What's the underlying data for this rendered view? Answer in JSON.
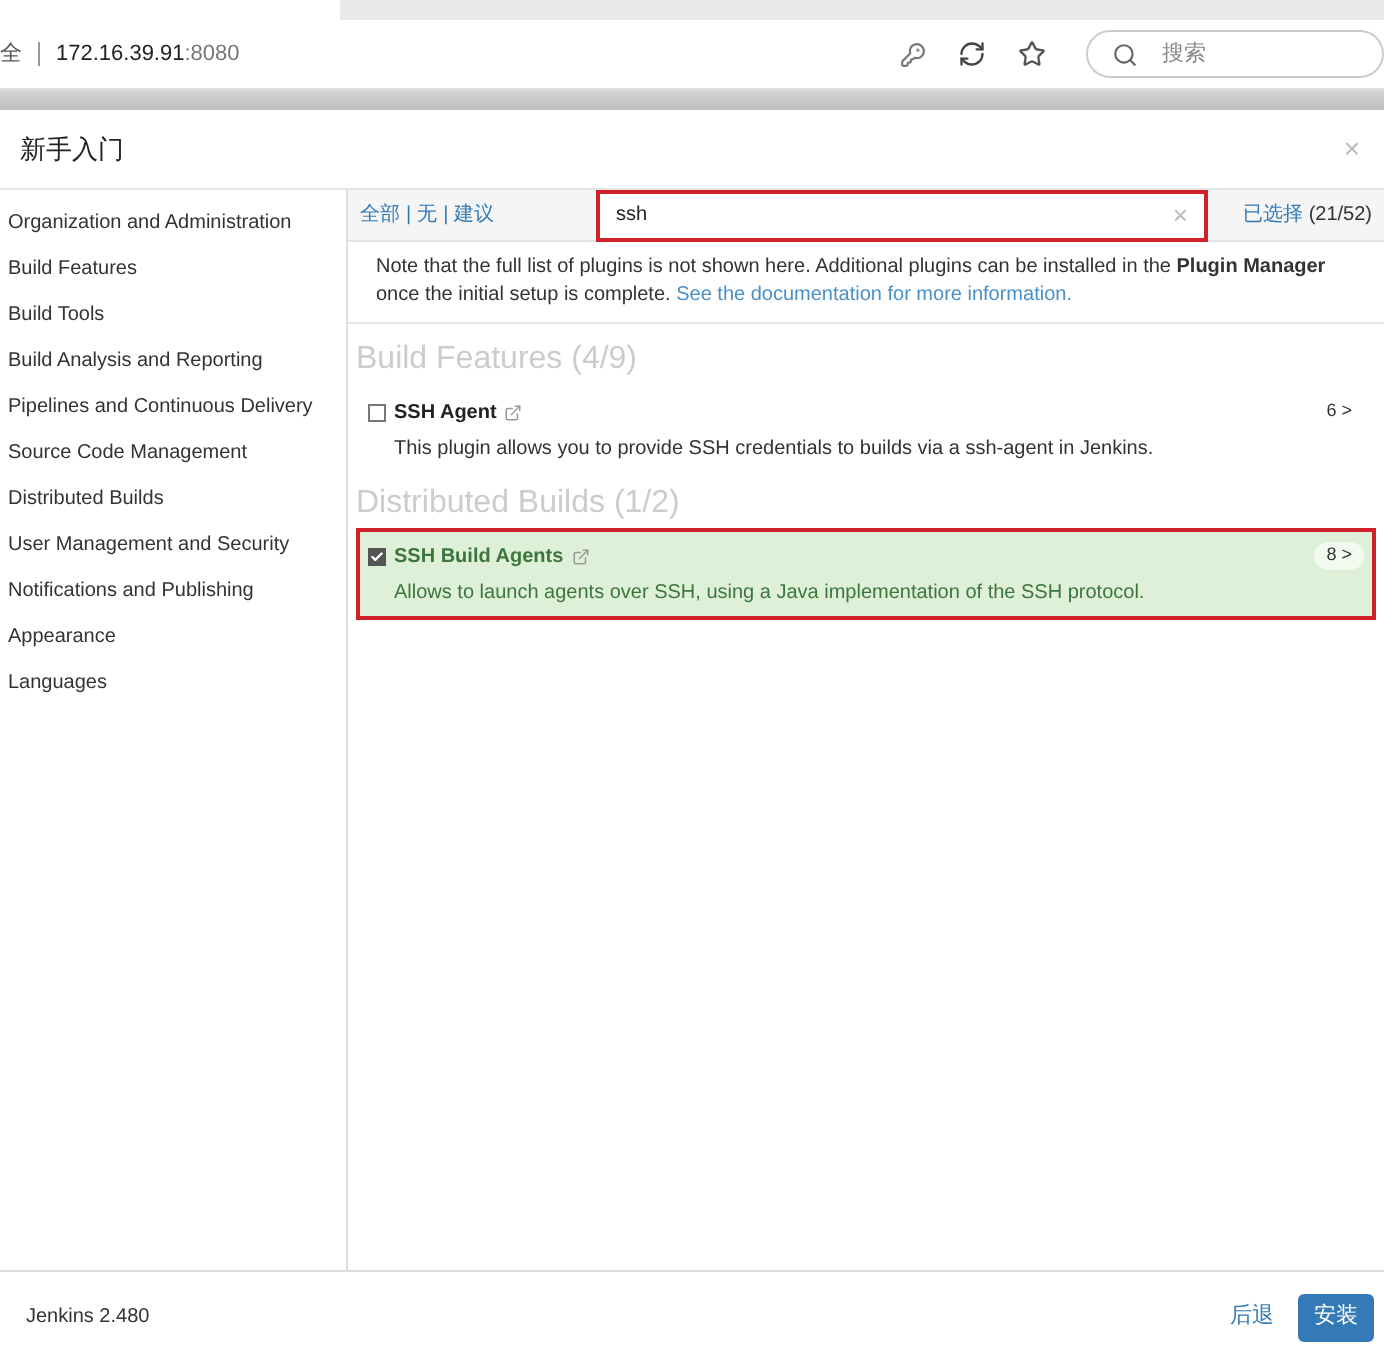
{
  "browser": {
    "address_prefix": "全",
    "address_host": "172.16.39.91",
    "address_port": ":8080",
    "search_placeholder": "搜索"
  },
  "dialog": {
    "title": "新手入门",
    "close": "×"
  },
  "sidebar": {
    "items": [
      {
        "label": "Organization and Administration"
      },
      {
        "label": "Build Features"
      },
      {
        "label": "Build Tools"
      },
      {
        "label": "Build Analysis and Reporting"
      },
      {
        "label": "Pipelines and Continuous Delivery"
      },
      {
        "label": "Source Code Management"
      },
      {
        "label": "Distributed Builds"
      },
      {
        "label": "User Management and Security"
      },
      {
        "label": "Notifications and Publishing"
      },
      {
        "label": "Appearance"
      },
      {
        "label": "Languages"
      }
    ]
  },
  "toolbar": {
    "links": [
      "全部",
      "无",
      "建议"
    ],
    "separator": "|",
    "search_value": "ssh",
    "search_highlighted": true,
    "clear": "×",
    "selected_label": "已选择",
    "selected_count": "(21/52)"
  },
  "note": {
    "text": "Note that the full list of plugins is not shown here. Additional plugins can be installed in the **Plugin Manager** once the initial setup is complete.",
    "link": "See the documentation for more information."
  },
  "groups": [
    {
      "title": "Build Features (4/9)",
      "plugins": [
        {
          "name": "SSH Agent",
          "checked": false,
          "highlighted": false,
          "deps": "6 >",
          "description": "This plugin allows you to provide SSH credentials to builds via a ssh-agent in Jenkins."
        }
      ]
    },
    {
      "title": "Distributed Builds (1/2)",
      "plugins": [
        {
          "name": "SSH Build Agents",
          "checked": true,
          "highlighted": true,
          "deps": "8 >",
          "description": "Allows to launch agents over SSH, using a Java implementation of the SSH protocol."
        }
      ]
    }
  ],
  "footer": {
    "version": "Jenkins 2.480",
    "back": "后退",
    "install": "安装"
  }
}
